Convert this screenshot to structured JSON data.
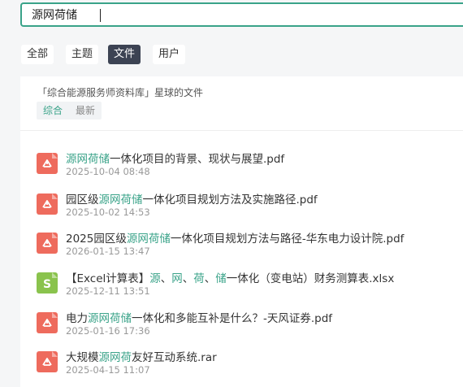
{
  "search": {
    "value": "源网荷储"
  },
  "tabs": [
    {
      "label": "全部",
      "active": false
    },
    {
      "label": "主题",
      "active": false
    },
    {
      "label": "文件",
      "active": true
    },
    {
      "label": "用户",
      "active": false
    }
  ],
  "scope_title": "「综合能源服务师资料库」星球的文件",
  "sort_tabs": [
    {
      "label": "综合",
      "active": true
    },
    {
      "label": "最新",
      "active": false
    }
  ],
  "files": [
    {
      "type": "pdf",
      "icon": "pdf-file-icon",
      "name_parts": [
        {
          "t": "源网荷储",
          "hl": true
        },
        {
          "t": "一体化项目的背景、现状与展望.pdf",
          "hl": false
        }
      ],
      "time": "2025-10-04 08:48"
    },
    {
      "type": "pdf",
      "icon": "pdf-file-icon",
      "name_parts": [
        {
          "t": "园区级",
          "hl": false
        },
        {
          "t": "源网荷储",
          "hl": true
        },
        {
          "t": "一体化项目规划方法及实施路径.pdf",
          "hl": false
        }
      ],
      "time": "2025-10-02 14:53"
    },
    {
      "type": "pdf",
      "icon": "pdf-file-icon",
      "name_parts": [
        {
          "t": "2025园区级",
          "hl": false
        },
        {
          "t": "源网荷储",
          "hl": true
        },
        {
          "t": "一体化项目规划方法与路径-华东电力设计院.pdf",
          "hl": false
        }
      ],
      "time": "2026-01-15 13:47"
    },
    {
      "type": "xlsx",
      "icon": "spreadsheet-file-icon",
      "name_parts": [
        {
          "t": "【Excel计算表】",
          "hl": false
        },
        {
          "t": "源",
          "hl": true
        },
        {
          "t": "、",
          "hl": false
        },
        {
          "t": "网",
          "hl": true
        },
        {
          "t": "、",
          "hl": false
        },
        {
          "t": "荷",
          "hl": true
        },
        {
          "t": "、",
          "hl": false
        },
        {
          "t": "储",
          "hl": true
        },
        {
          "t": "一体化（变电站）财务测算表.xlsx",
          "hl": false
        }
      ],
      "time": "2025-12-11 13:51"
    },
    {
      "type": "pdf",
      "icon": "pdf-file-icon",
      "name_parts": [
        {
          "t": "电力",
          "hl": false
        },
        {
          "t": "源网荷储",
          "hl": true
        },
        {
          "t": "一体化和多能互补是什么？-天风证券.pdf",
          "hl": false
        }
      ],
      "time": "2025-01-16 17:36"
    },
    {
      "type": "pdf",
      "icon": "pdf-file-icon",
      "name_parts": [
        {
          "t": "大规模",
          "hl": false
        },
        {
          "t": "源网荷",
          "hl": true
        },
        {
          "t": "友好互动系统.rar",
          "hl": false
        }
      ],
      "time": "2025-04-15 11:07"
    }
  ],
  "colors": {
    "accent": "#3aa389",
    "active_tab_bg": "#3c4353",
    "pdf_icon": "#ee6b5d",
    "xlsx_icon": "#8ac34d"
  }
}
